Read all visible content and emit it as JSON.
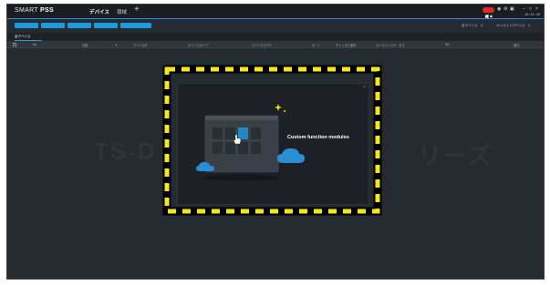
{
  "app": {
    "logo_prefix": "SMART ",
    "logo_suffix": "PSS",
    "tabs": [
      {
        "label": "デバイス",
        "active": true
      },
      {
        "label": "領域",
        "active": false
      }
    ],
    "add_tab": "+",
    "clock": "16:31:28",
    "accent": "#1a9be0",
    "alarm_color": "#e02a2a"
  },
  "toolbar": {
    "buttons": [
      "",
      "",
      "",
      "",
      ""
    ],
    "stats": [
      {
        "label": "全デバイス",
        "value": "0"
      },
      {
        "label": "オンラインデバイス",
        "value": "0"
      }
    ]
  },
  "subtab": {
    "label": "全デバイス"
  },
  "table": {
    "columns": [
      "No.",
      "名前",
      "デバイスIP",
      "デバイスタイプ",
      "デバイスモデル",
      "ポート",
      "チャンネル番号",
      "オンラインステータス",
      "SN",
      "操作"
    ]
  },
  "modal": {
    "title": "Custom function modules",
    "close": "×"
  },
  "watermark": {
    "left": "TS-D",
    "right": "リーズ"
  },
  "icons": [
    "alarm-icon",
    "user-icon",
    "settings-icon",
    "lock-icon",
    "minimize-icon",
    "maximize-icon",
    "close-icon",
    "hand-pointer-icon",
    "cloud-icon",
    "sparkle-icon"
  ]
}
